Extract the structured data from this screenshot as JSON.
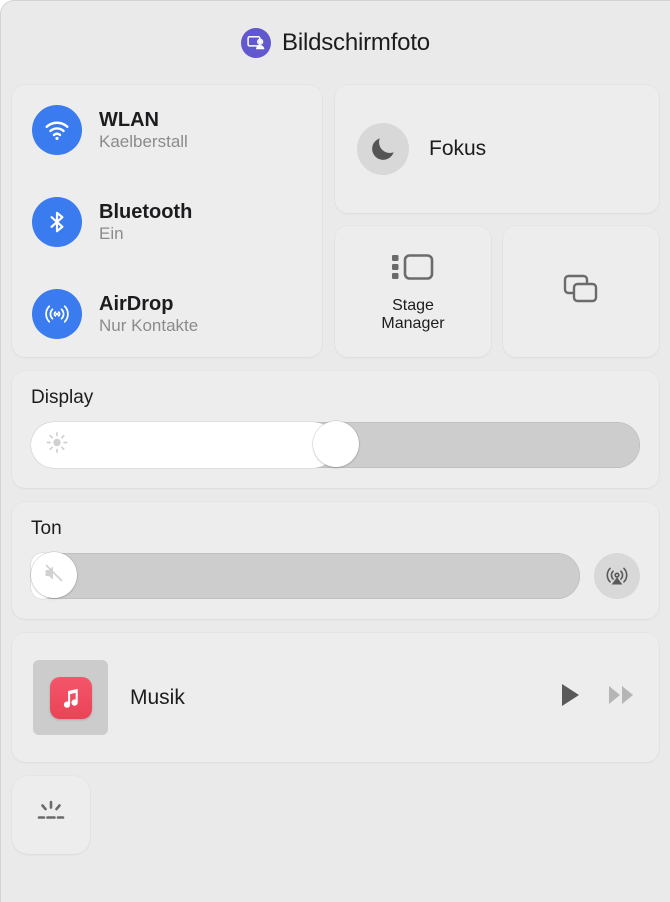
{
  "window": {
    "title": "Bildschirmfoto",
    "app_icon": "screenshot-app-icon",
    "background_color": "#eaeaea",
    "panel_color": "#ededed"
  },
  "connectivity": {
    "accent_color": "#3a7bf0",
    "items": [
      {
        "icon": "wifi-icon",
        "title": "WLAN",
        "status": "Kaelberstall"
      },
      {
        "icon": "bluetooth-icon",
        "title": "Bluetooth",
        "status": "Ein"
      },
      {
        "icon": "airdrop-icon",
        "title": "AirDrop",
        "status": "Nur Kontakte"
      }
    ]
  },
  "focus": {
    "label": "Fokus",
    "icon": "moon-icon"
  },
  "tiles": [
    {
      "label": "Stage\nManager",
      "label_line1": "Stage",
      "label_line2": "Manager",
      "icon": "stage-manager-icon"
    },
    {
      "label": "",
      "icon": "screen-mirroring-icon"
    }
  ],
  "display": {
    "heading": "Display",
    "icon": "brightness-sun-icon",
    "value": 50,
    "min": 0,
    "max": 100
  },
  "sound": {
    "heading": "Ton",
    "icon": "volume-mute-icon",
    "value": 0,
    "min": 0,
    "max": 100,
    "airplay_icon": "airplay-audio-icon"
  },
  "media": {
    "title": "Musik",
    "artwork_icon": "apple-music-icon",
    "artwork_color": "#ea4356",
    "play_icon": "play-icon",
    "forward_icon": "fast-forward-icon",
    "play_color": "#5a5a5a",
    "forward_color": "#b5b5b5"
  },
  "keyboard_brightness": {
    "icon": "keyboard-brightness-icon"
  }
}
